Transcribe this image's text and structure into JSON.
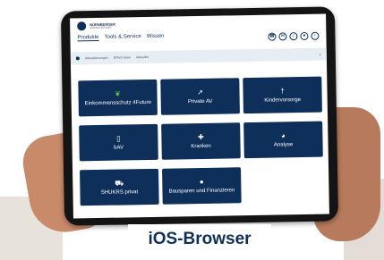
{
  "app": {
    "brand": "NÜRNBERGER",
    "brand_sub": "VERSICHERUNG"
  },
  "nav": {
    "items": [
      {
        "label": "Produkte",
        "active": true
      },
      {
        "label": "Tools & Service"
      },
      {
        "label": "Wissen"
      }
    ],
    "icons": [
      "phone-icon",
      "mail-icon",
      "home-icon",
      "user-icon",
      "info-icon"
    ]
  },
  "infobar": {
    "links": [
      "Aktualisierungen",
      "EPfad News",
      "Aktuelles"
    ],
    "close": "×"
  },
  "tiles": [
    {
      "label": "Einkommensschutz 4Future",
      "icon": "leaf-icon",
      "glyph": "❦"
    },
    {
      "label": "Private AV",
      "icon": "chart-icon",
      "glyph": "↗"
    },
    {
      "label": "Kindervorsorge",
      "icon": "child-icon",
      "glyph": "†"
    },
    {
      "label": "bAV",
      "icon": "building-icon",
      "glyph": "▯"
    },
    {
      "label": "Kranken",
      "icon": "medical-kit-icon",
      "glyph": "✚"
    },
    {
      "label": "Analyse",
      "icon": "pie-chart-icon",
      "glyph": "◕"
    },
    {
      "label": "SHUKRS privat",
      "icon": "car-icon",
      "glyph": "⛟"
    },
    {
      "label": "Bausparen und Finanzieren",
      "icon": "piggy-bank-icon",
      "glyph": "●"
    }
  ],
  "overlay": {
    "label": "iOS-Browser"
  },
  "colors": {
    "tile": "#0e2f5a",
    "accent": "#6cc24a"
  }
}
